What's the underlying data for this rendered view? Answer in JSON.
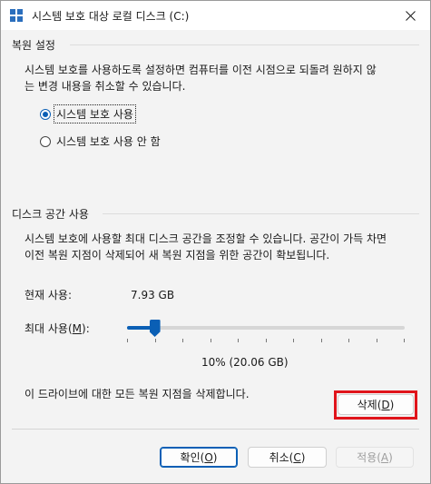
{
  "window": {
    "title": "시스템 보호 대상 로컬 디스크 (C:)"
  },
  "restore": {
    "heading": "복원 설정",
    "desc_line1": "시스템 보호를 사용하도록 설정하면 컴퓨터를 이전 시점으로 되돌려 원하지 않",
    "desc_line2": "는 변경 내용을 취소할 수 있습니다.",
    "options": [
      {
        "label": "시스템 보호 사용",
        "selected": true
      },
      {
        "label": "시스템 보호 사용 안 함",
        "selected": false
      }
    ]
  },
  "disk": {
    "heading": "디스크 공간 사용",
    "desc_line1": "시스템 보호에 사용할 최대 디스크 공간을 조정할 수 있습니다. 공간이 가득 차면",
    "desc_line2": "이전 복원 지점이 삭제되어 새 복원 지점을 위한 공간이 확보됩니다.",
    "current_label": "현재 사용:",
    "current_value": "7.93 GB",
    "max_label_prefix": "최대 사용(",
    "max_label_key": "M",
    "max_label_suffix": "):",
    "slider_percent": 10,
    "slider_value_text": "10% (20.06 GB)",
    "delete_desc": "이 드라이브에 대한 모든 복원 지점을 삭제합니다.",
    "delete_prefix": "삭제(",
    "delete_key": "D",
    "delete_suffix": ")"
  },
  "footer": {
    "ok_prefix": "확인(",
    "ok_key": "O",
    "ok_suffix": ")",
    "cancel_prefix": "취소(",
    "cancel_key": "C",
    "cancel_suffix": ")",
    "apply_prefix": "적용(",
    "apply_key": "A",
    "apply_suffix": ")"
  },
  "colors": {
    "accent": "#0a5fb5",
    "highlight": "#e0141b"
  }
}
